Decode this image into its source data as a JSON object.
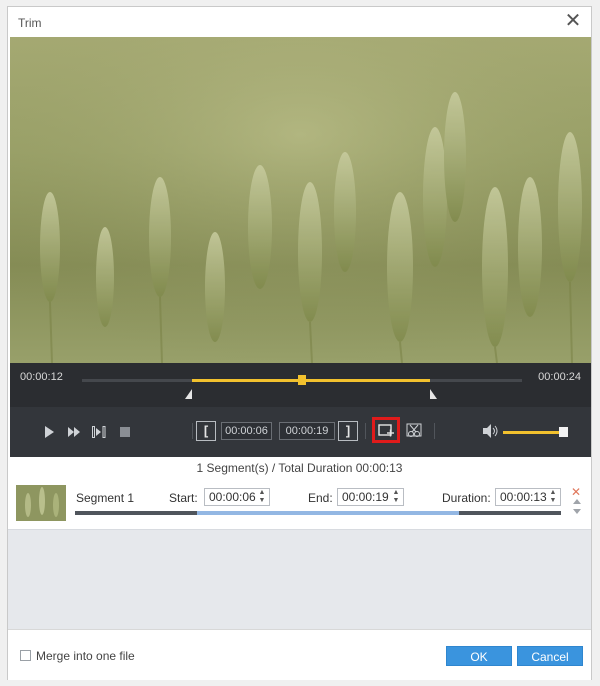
{
  "window": {
    "title": "Trim",
    "close_glyph": "✕"
  },
  "timeline": {
    "current": "00:00:12",
    "total": "00:00:24",
    "selection_start_fraction": 0.25,
    "selection_end_fraction": 0.79,
    "playhead_fraction": 0.5
  },
  "controls": {
    "start_bracket": "[",
    "start_time": "00:00:06",
    "end_time": "00:00:19",
    "end_bracket": "]",
    "volume_fraction": 0.95,
    "icons": [
      "play-icon",
      "fast-forward-icon",
      "step-frame-icon",
      "stop-icon",
      "add-segment-icon",
      "split-scissors-icon",
      "volume-icon"
    ]
  },
  "summary": "1 Segment(s) / Total Duration 00:00:13",
  "segment": {
    "label": "Segment 1",
    "start_label": "Start:",
    "start_value": "00:00:06",
    "end_label": "End:",
    "end_value": "00:00:19",
    "duration_label": "Duration:",
    "duration_value": "00:00:13",
    "delete_glyph": "✕",
    "progress_start_fraction": 0.25,
    "progress_end_fraction": 0.79
  },
  "footer": {
    "merge_label": "Merge into one file",
    "ok_label": "OK",
    "cancel_label": "Cancel"
  },
  "colors": {
    "accent": "#f2c12e",
    "button": "#3a94de",
    "highlight": "#e01b1b"
  }
}
